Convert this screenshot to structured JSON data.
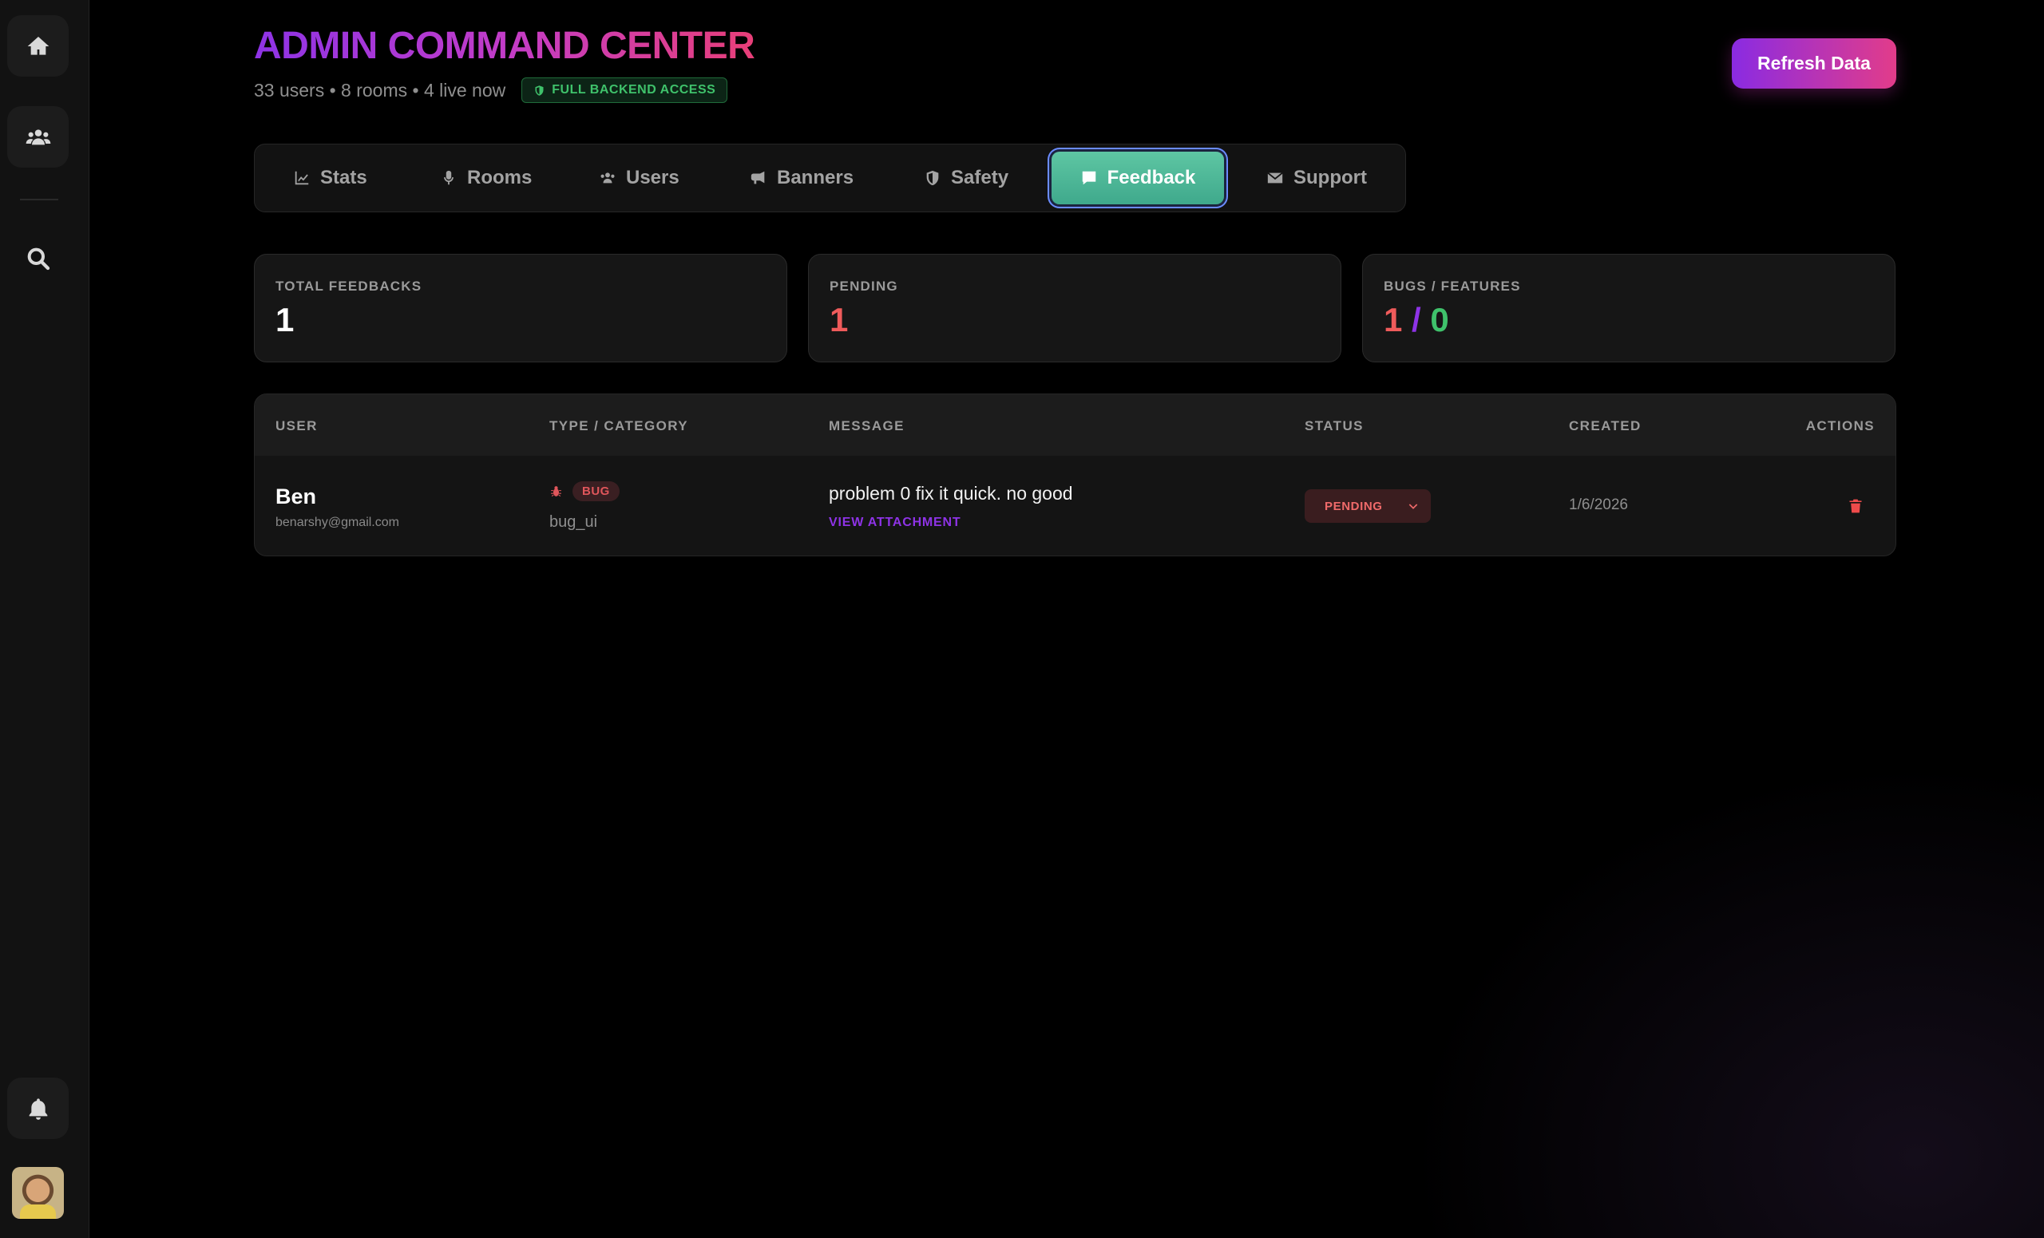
{
  "header": {
    "title": "ADMIN COMMAND CENTER",
    "summary": "33 users • 8 rooms • 4 live now",
    "access_badge": "FULL BACKEND ACCESS",
    "refresh_label": "Refresh Data"
  },
  "sidebar": {
    "items": [
      {
        "name": "home",
        "icon": "home-icon"
      },
      {
        "name": "community",
        "icon": "users-icon"
      },
      {
        "name": "search",
        "icon": "search-icon"
      },
      {
        "name": "notifications",
        "icon": "bell-icon"
      },
      {
        "name": "profile",
        "icon": "avatar"
      }
    ]
  },
  "tabs": [
    {
      "label": "Stats",
      "icon": "chart-line-icon"
    },
    {
      "label": "Rooms",
      "icon": "microphone-icon"
    },
    {
      "label": "Users",
      "icon": "users-icon"
    },
    {
      "label": "Banners",
      "icon": "bullhorn-icon"
    },
    {
      "label": "Safety",
      "icon": "shield-icon"
    },
    {
      "label": "Feedback",
      "icon": "comment-icon",
      "active": true
    },
    {
      "label": "Support",
      "icon": "envelope-icon"
    }
  ],
  "stats": {
    "total_label": "TOTAL FEEDBACKS",
    "total_value": "1",
    "pending_label": "PENDING",
    "pending_value": "1",
    "bugs_features_label": "BUGS / FEATURES",
    "bugs_value": "1",
    "separator": "/",
    "features_value": "0"
  },
  "table": {
    "headers": [
      "USER",
      "TYPE / CATEGORY",
      "MESSAGE",
      "STATUS",
      "CREATED",
      "ACTIONS"
    ],
    "rows": [
      {
        "user_name": "Ben",
        "user_email": "benarshy@gmail.com",
        "type": "BUG",
        "category": "bug_ui",
        "message": "problem 0 fix it quick. no good",
        "attachment_label": "VIEW ATTACHMENT",
        "status": "PENDING",
        "created": "1/6/2026"
      }
    ]
  },
  "colors": {
    "accent_purple": "#8a2be2",
    "accent_pink": "#e23c8a",
    "active_tab": "#4fb897",
    "danger": "#e0565b",
    "success": "#3fc26b"
  }
}
